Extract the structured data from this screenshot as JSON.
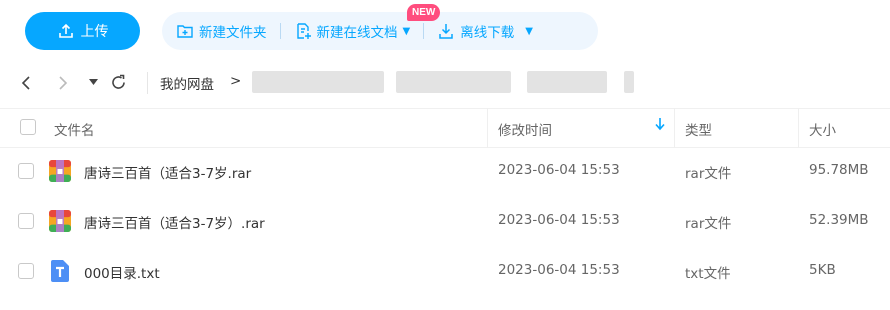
{
  "toolbar": {
    "upload_label": "上传",
    "new_folder_label": "新建文件夹",
    "new_online_doc_label": "新建在线文档",
    "new_badge": "NEW",
    "offline_download_label": "离线下载"
  },
  "breadcrumb": {
    "root": "我的网盘",
    "separator": ">"
  },
  "table": {
    "columns": {
      "name": "文件名",
      "modified": "修改时间",
      "type": "类型",
      "size": "大小"
    },
    "rows": [
      {
        "name": "唐诗三百首（适合3-7岁.rar",
        "modified": "2023-06-04 15:53",
        "type": "rar文件",
        "size": "95.78MB",
        "icon": "rar-archive-icon"
      },
      {
        "name": "唐诗三百首（适合3-7岁）.rar",
        "modified": "2023-06-04 15:53",
        "type": "rar文件",
        "size": "52.39MB",
        "icon": "rar-archive-icon"
      },
      {
        "name": "000目录.txt",
        "modified": "2023-06-04 15:53",
        "type": "txt文件",
        "size": "5KB",
        "icon": "txt-file-icon"
      }
    ]
  },
  "colors": {
    "accent": "#06a7ff",
    "badge": "#ff4d7e"
  }
}
